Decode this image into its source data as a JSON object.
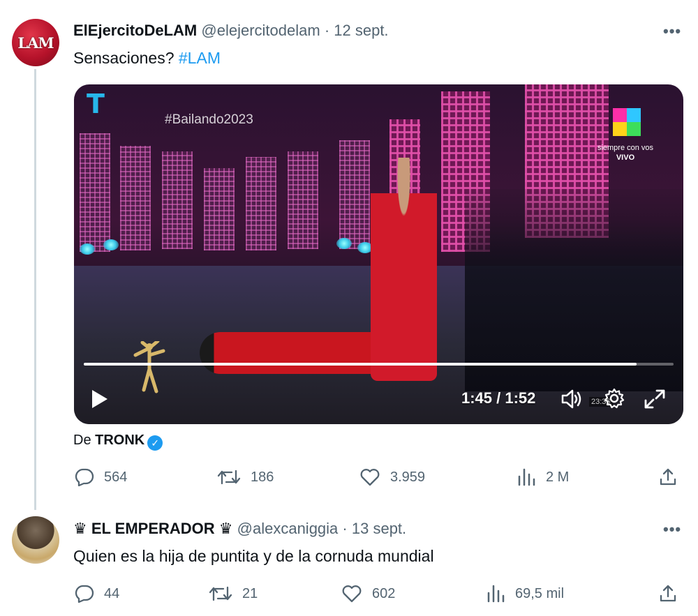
{
  "tweet1": {
    "avatar_text": "LAM",
    "name": "ElEjercitoDeLAM",
    "handle": "@elejercitodelam",
    "dot": "·",
    "date": "12 sept.",
    "more": "•••",
    "text": "Sensaciones?",
    "hashtag": "#LAM",
    "video": {
      "overlay_hashtag": "#Bailando2023",
      "channel_caption_1": "siempre con vos",
      "channel_caption_2": "VIVO",
      "time": "1:45 / 1:52",
      "progress": 0.937,
      "mini_clock": "23:36"
    },
    "from_prefix": "De",
    "from_name": "TRONK",
    "stats": {
      "replies": "564",
      "retweets": "186",
      "likes": "3.959",
      "views": "2 M"
    }
  },
  "tweet2": {
    "name": "♛ EL EMPERADOR ♛",
    "handle": "@alexcaniggia",
    "dot": "·",
    "date": "13 sept.",
    "more": "•••",
    "text": "Quien es la hija de puntita y de la cornuda mundial",
    "stats": {
      "replies": "44",
      "retweets": "21",
      "likes": "602",
      "views": "69,5 mil"
    }
  },
  "colors": {
    "accent": "#1d9bf0",
    "muted": "#536471",
    "text": "#0f1419",
    "thread_line": "#cfd9de"
  }
}
